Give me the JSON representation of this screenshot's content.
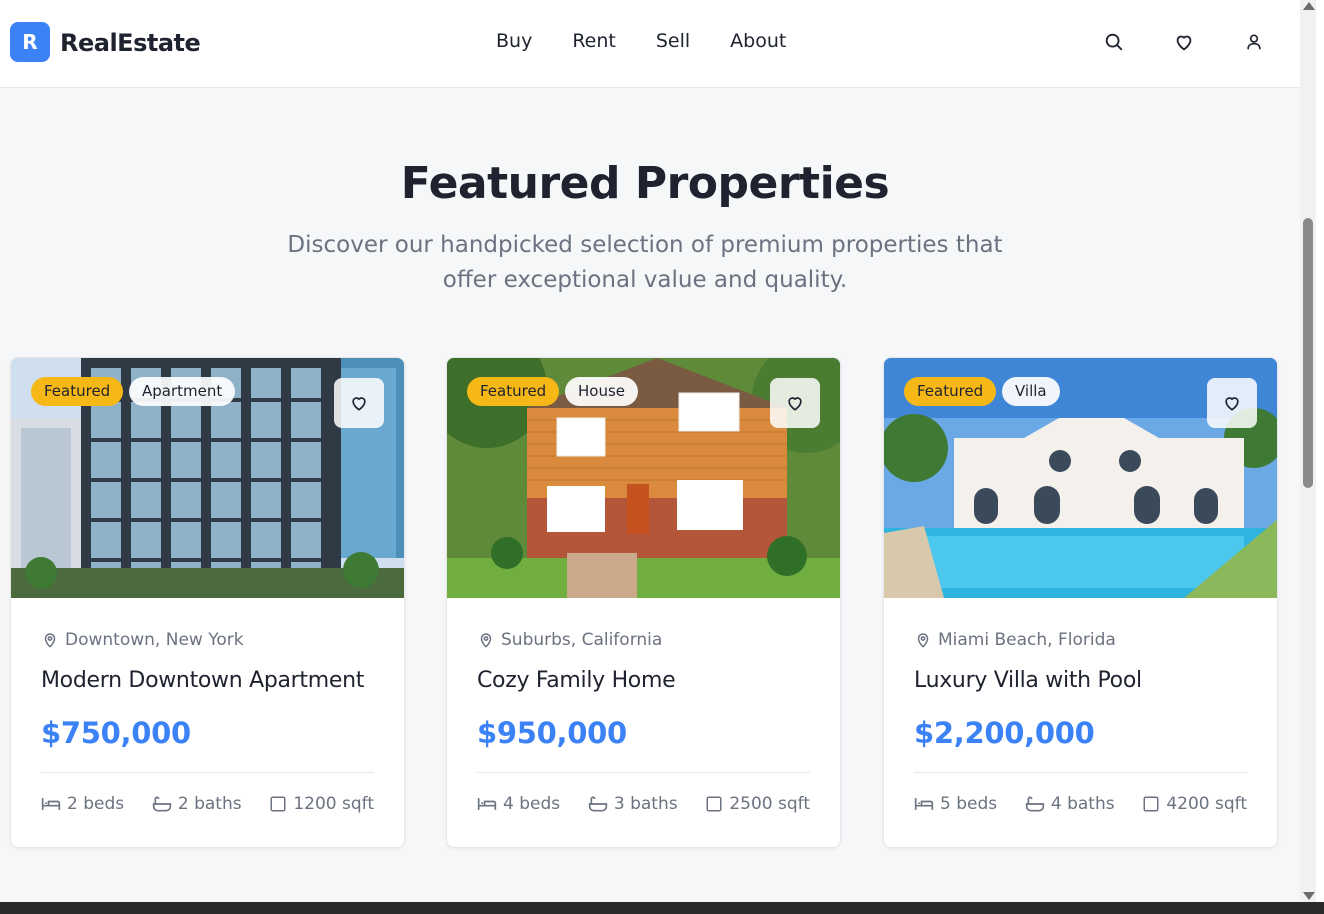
{
  "brand": {
    "logo_letter": "R",
    "name": "RealEstate",
    "color": "#3b82f6"
  },
  "nav": {
    "items": [
      "Buy",
      "Rent",
      "Sell",
      "About"
    ]
  },
  "header_icons": [
    "search-icon",
    "heart-icon",
    "user-icon"
  ],
  "hero": {
    "title": "Featured Properties",
    "subtitle": "Discover our handpicked selection of premium properties that offer exceptional value and quality."
  },
  "colors": {
    "accent": "#3b82f6",
    "featured_badge": "#f6b817",
    "muted_text": "#6b7280"
  },
  "properties": [
    {
      "badge": "Featured",
      "type": "Apartment",
      "location": "Downtown, New York",
      "name": "Modern Downtown Apartment",
      "price": "$750,000",
      "beds": "2 beds",
      "baths": "2 baths",
      "area": "1200 sqft"
    },
    {
      "badge": "Featured",
      "type": "House",
      "location": "Suburbs, California",
      "name": "Cozy Family Home",
      "price": "$950,000",
      "beds": "4 beds",
      "baths": "3 baths",
      "area": "2500 sqft"
    },
    {
      "badge": "Featured",
      "type": "Villa",
      "location": "Miami Beach, Florida",
      "name": "Luxury Villa with Pool",
      "price": "$2,200,000",
      "beds": "5 beds",
      "baths": "4 baths",
      "area": "4200 sqft"
    }
  ]
}
